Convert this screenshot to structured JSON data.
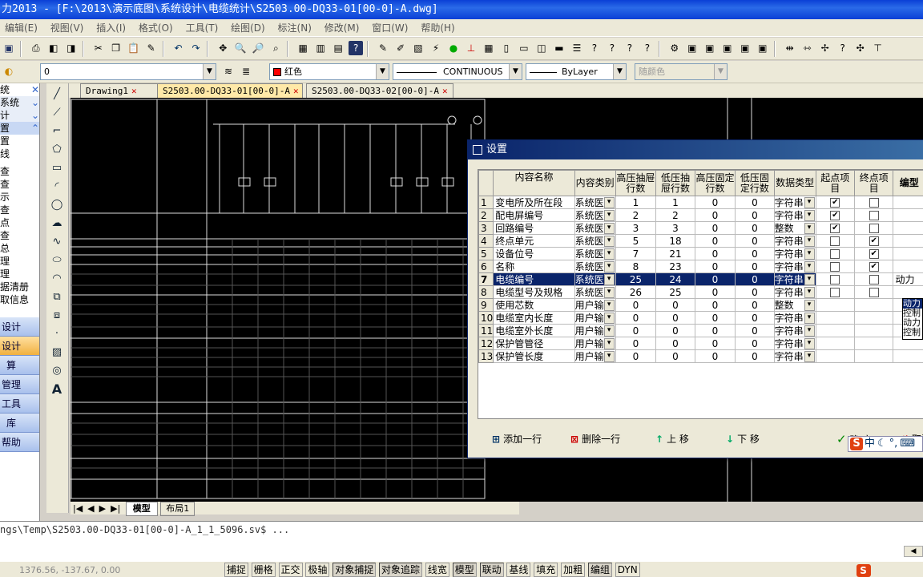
{
  "window": {
    "title": "力2013 - [F:\\2013\\演示底图\\系统设计\\电缆统计\\S2503.00-DQ33-01[00-0]-A.dwg]"
  },
  "menu": [
    "编辑(E)",
    "视图(V)",
    "插入(I)",
    "格式(O)",
    "工具(T)",
    "绘图(D)",
    "标注(N)",
    "修改(M)",
    "窗口(W)",
    "帮助(H)"
  ],
  "layer_bar": {
    "layer": "0",
    "color": "红色",
    "color_hex": "#ff0000",
    "linetype": "CONTINUOUS",
    "lineweight": "ByLayer",
    "plotstyle": "随颜色"
  },
  "left_panel": {
    "items": [
      "统",
      "系统",
      "计",
      "置",
      "置",
      "线",
      "查",
      "查",
      "示",
      "查",
      "点",
      "查",
      "总",
      "理",
      "理",
      "据清册",
      "取信息"
    ],
    "buttons": [
      "设计",
      "设计",
      "算",
      "管理",
      "工具",
      "库",
      "帮助"
    ]
  },
  "doc_tabs": [
    "Drawing1",
    "S2503.00-DQ33-01[00-0]-A",
    "S2503.00-DQ33-02[00-0]-A"
  ],
  "model_tabs": {
    "model": "模型",
    "layout": "布局1"
  },
  "command_line": "ngs\\Temp\\S2503.00-DQ33-01[00-0]-A_1_1_5096.sv$ ...",
  "status": {
    "coords": "1376.56, -137.67, 0.00",
    "buttons": [
      "捕捉",
      "栅格",
      "正交",
      "极轴",
      "对象捕捉",
      "对象追踪",
      "线宽",
      "模型",
      "联动",
      "基线",
      "填充",
      "加粗",
      "编组",
      "DYN"
    ]
  },
  "dialog": {
    "title": "设置",
    "columns": [
      "内容名称",
      "内容类别",
      "高压抽屉行数",
      "低压抽屉行数",
      "高压固定行数",
      "低压固定行数",
      "数据类型",
      "起点项目",
      "终点项目",
      "编型"
    ],
    "rows": [
      {
        "n": "1",
        "name": "变电所及所在段",
        "cat": "系统医",
        "hd": "1",
        "ld": "1",
        "hf": "0",
        "lf": "0",
        "type": "字符串",
        "start": true,
        "end": false
      },
      {
        "n": "2",
        "name": "配电屏编号",
        "cat": "系统医",
        "hd": "2",
        "ld": "2",
        "hf": "0",
        "lf": "0",
        "type": "字符串",
        "start": true,
        "end": false
      },
      {
        "n": "3",
        "name": "回路编号",
        "cat": "系统医",
        "hd": "3",
        "ld": "3",
        "hf": "0",
        "lf": "0",
        "type": "整数",
        "start": true,
        "end": false
      },
      {
        "n": "4",
        "name": "终点单元",
        "cat": "系统医",
        "hd": "5",
        "ld": "18",
        "hf": "0",
        "lf": "0",
        "type": "字符串",
        "start": false,
        "end": true
      },
      {
        "n": "5",
        "name": "设备位号",
        "cat": "系统医",
        "hd": "7",
        "ld": "21",
        "hf": "0",
        "lf": "0",
        "type": "字符串",
        "start": false,
        "end": true
      },
      {
        "n": "6",
        "name": "名称",
        "cat": "系统医",
        "hd": "8",
        "ld": "23",
        "hf": "0",
        "lf": "0",
        "type": "字符串",
        "start": false,
        "end": true
      },
      {
        "n": "7",
        "name": "电缆编号",
        "cat": "系统医",
        "hd": "25",
        "ld": "24",
        "hf": "0",
        "lf": "0",
        "type": "字符串",
        "start": false,
        "end": false,
        "extra": "动力"
      },
      {
        "n": "8",
        "name": "电缆型号及规格",
        "cat": "系统医",
        "hd": "26",
        "ld": "25",
        "hf": "0",
        "lf": "0",
        "type": "字符串",
        "start": false,
        "end": false
      },
      {
        "n": "9",
        "name": "使用芯数",
        "cat": "用户输",
        "hd": "0",
        "ld": "0",
        "hf": "0",
        "lf": "0",
        "type": "整数"
      },
      {
        "n": "10",
        "name": "电缆室内长度",
        "cat": "用户输",
        "hd": "0",
        "ld": "0",
        "hf": "0",
        "lf": "0",
        "type": "字符串"
      },
      {
        "n": "11",
        "name": "电缆室外长度",
        "cat": "用户输",
        "hd": "0",
        "ld": "0",
        "hf": "0",
        "lf": "0",
        "type": "字符串"
      },
      {
        "n": "12",
        "name": "保护管管径",
        "cat": "用户输",
        "hd": "0",
        "ld": "0",
        "hf": "0",
        "lf": "0",
        "type": "字符串"
      },
      {
        "n": "13",
        "name": "保护管长度",
        "cat": "用户输",
        "hd": "0",
        "ld": "0",
        "hf": "0",
        "lf": "0",
        "type": "字符串"
      }
    ],
    "popup_items": [
      "动力",
      "控制",
      "动力",
      "控制"
    ],
    "buttons": {
      "add": "添加一行",
      "delete": "删除一行",
      "up": "上 移",
      "down": "下 移",
      "ok": "确 定",
      "cancel": "取消"
    },
    "selected_row": 7
  },
  "ime": {
    "label": "中"
  }
}
